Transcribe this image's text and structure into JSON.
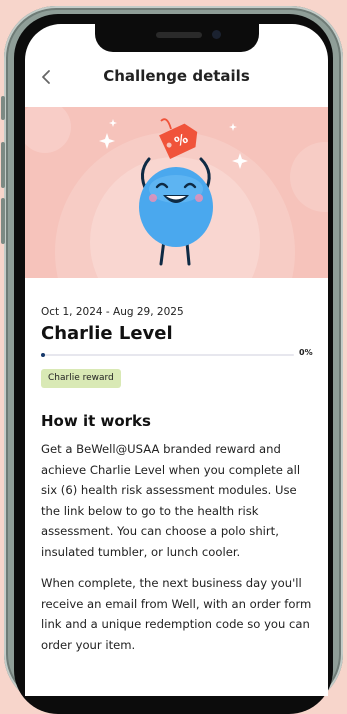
{
  "header": {
    "back_icon": "chevron-left-icon",
    "title": "Challenge details"
  },
  "challenge": {
    "dates": "Oct 1, 2024 - Aug 29, 2025",
    "name": "Charlie Level",
    "progress_percent": 0,
    "progress_label": "0%",
    "badge": "Charlie reward"
  },
  "how_it_works": {
    "heading": "How it works",
    "paragraph_1": "Get a BeWell@USAA branded reward and achieve Charlie Level when you complete all six (6) health risk assessment modules. Use the link below to go to the health risk assessment. You can choose a polo shirt, insulated tumbler, or lunch cooler.",
    "paragraph_2": "When complete, the next business day you'll receive an email from Well, with an order form link and a unique redemption code so you can order your item."
  },
  "hero": {
    "mascot": "blue-mascot-holding-percent-tag",
    "tag_text": "%",
    "colors": {
      "background": "#f6c3bb",
      "mascot": "#4aa8ee",
      "tag": "#f0533a"
    }
  }
}
